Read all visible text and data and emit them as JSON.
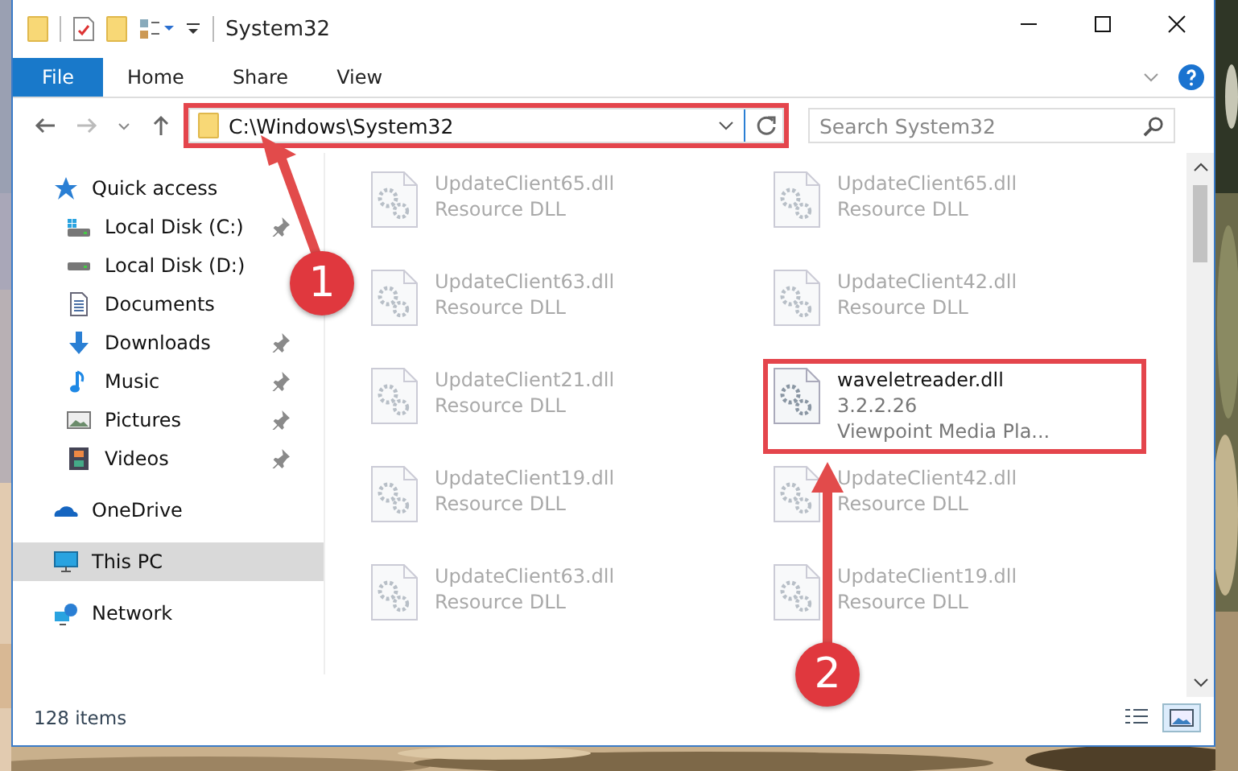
{
  "window": {
    "title": "System32"
  },
  "ribbon_tabs": [
    {
      "label": "File",
      "kind": "file"
    },
    {
      "label": "Home",
      "kind": "tab"
    },
    {
      "label": "Share",
      "kind": "tab"
    },
    {
      "label": "View",
      "kind": "tab"
    }
  ],
  "address": {
    "path": "C:\\Windows\\System32",
    "highlighted": true
  },
  "search": {
    "placeholder": "Search System32"
  },
  "sidebar": {
    "items": [
      {
        "label": "Quick access",
        "kind": "star",
        "selected": false,
        "children": [
          {
            "label": "Local Disk (C:)",
            "kind": "drive-c",
            "pinned": true,
            "selected": false
          },
          {
            "label": "Local Disk (D:)",
            "kind": "drive",
            "pinned": false,
            "selected": false
          },
          {
            "label": "Documents",
            "kind": "documents",
            "pinned": false,
            "selected": false
          },
          {
            "label": "Downloads",
            "kind": "downloads",
            "pinned": true,
            "selected": false
          },
          {
            "label": "Music",
            "kind": "music",
            "pinned": true,
            "selected": false
          },
          {
            "label": "Pictures",
            "kind": "pictures",
            "pinned": true,
            "selected": false
          },
          {
            "label": "Videos",
            "kind": "videos",
            "pinned": true,
            "selected": false
          }
        ]
      },
      {
        "label": "OneDrive",
        "kind": "cloud",
        "selected": false
      },
      {
        "label": "This PC",
        "kind": "pc",
        "selected": true
      },
      {
        "label": "Network",
        "kind": "network",
        "selected": false
      }
    ]
  },
  "files": [
    {
      "name": "UpdateClient65.dll",
      "lines": [
        "Resource DLL"
      ],
      "faded": true,
      "highlighted": false
    },
    {
      "name": "UpdateClient65.dll",
      "lines": [
        "Resource DLL"
      ],
      "faded": true,
      "highlighted": false
    },
    {
      "name": "UpdateClient63.dll",
      "lines": [
        "Resource DLL"
      ],
      "faded": true,
      "highlighted": false
    },
    {
      "name": "UpdateClient42.dll",
      "lines": [
        "Resource DLL"
      ],
      "faded": true,
      "highlighted": false
    },
    {
      "name": "UpdateClient21.dll",
      "lines": [
        "Resource DLL"
      ],
      "faded": true,
      "highlighted": false
    },
    {
      "name": "waveletreader.dll",
      "lines": [
        "3.2.2.26",
        "Viewpoint Media Pla..."
      ],
      "faded": false,
      "highlighted": true
    },
    {
      "name": "UpdateClient19.dll",
      "lines": [
        "Resource DLL"
      ],
      "faded": true,
      "highlighted": false
    },
    {
      "name": "UpdateClient42.dll",
      "lines": [
        "Resource DLL"
      ],
      "faded": true,
      "highlighted": false
    },
    {
      "name": "UpdateClient63.dll",
      "lines": [
        "Resource DLL"
      ],
      "faded": true,
      "highlighted": false
    },
    {
      "name": "UpdateClient19.dll",
      "lines": [
        "Resource DLL"
      ],
      "faded": true,
      "highlighted": false
    }
  ],
  "status_bar": {
    "count": "128 items",
    "views": [
      {
        "kind": "details",
        "selected": false
      },
      {
        "kind": "large-icons",
        "selected": true
      }
    ]
  },
  "callouts": [
    {
      "number": "1"
    },
    {
      "number": "2"
    }
  ]
}
